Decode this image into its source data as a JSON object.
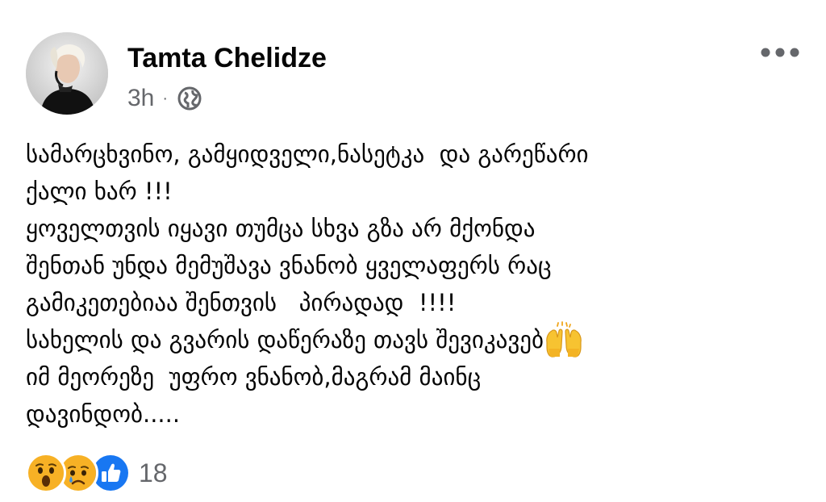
{
  "post": {
    "author": {
      "name": "Tamta Chelidze"
    },
    "meta": {
      "time": "3h",
      "separator": "·",
      "audience_icon": "globe-icon"
    },
    "more_icon": "more-horizontal-icon",
    "text_lines": [
      "სამარცხვინო, გამყიდველი,ნასეტკა  და გარეწარი",
      "ქალი ხარ !!!",
      "ყოველთვის იყავი თუმცა სხვა გზა არ მქონდა",
      "შენთან უნდა მემუშავა ვნანობ ყველაფერს რაც",
      "გამიკეთებიაა შენთვის   პირადად  !!!!",
      "სახელის და გვარის დაწერაზე თავს შევიკავებ",
      "იმ მეორეზე  უფრო ვნანობ,მაგრამ მაინც",
      "დავინდობ....."
    ],
    "inline_emoji": "raising-hands-emoji",
    "reactions": {
      "icons": [
        "wow-reaction-icon",
        "sad-reaction-icon",
        "like-reaction-icon"
      ],
      "count": "18"
    },
    "colors": {
      "text": "#050505",
      "secondary": "#65676b",
      "like_blue": "#1877f2",
      "reaction_yellow": "#f7b125"
    }
  }
}
